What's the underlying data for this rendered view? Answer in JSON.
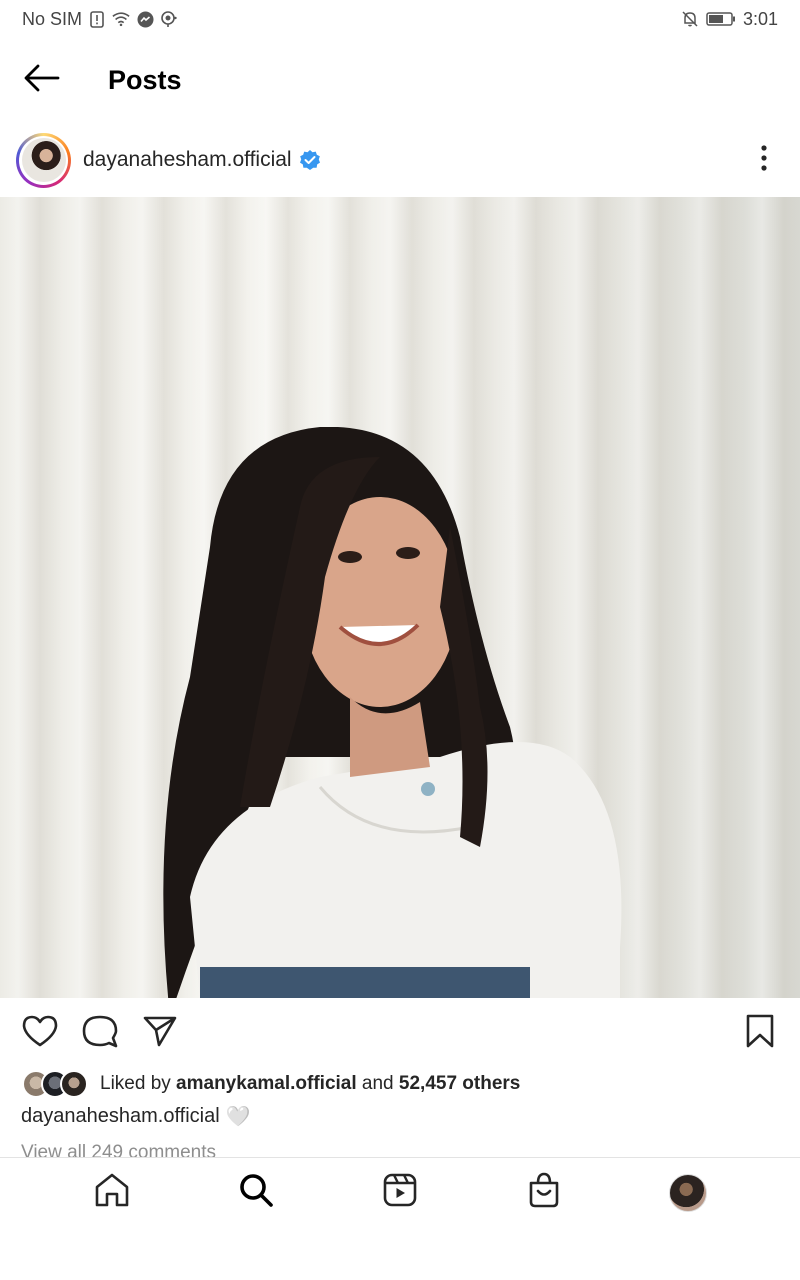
{
  "status_bar": {
    "carrier": "No SIM",
    "time": "3:01",
    "icons": [
      "sim-alert-icon",
      "wifi-icon",
      "messenger-icon",
      "hotspot-icon",
      "mute-bell-icon",
      "battery-icon"
    ]
  },
  "header": {
    "title": "Posts",
    "back_icon": "arrow-left-icon"
  },
  "post": {
    "author": "dayanahesham.official",
    "verified": true,
    "liked_by_prefix": "Liked by ",
    "liked_by_user": "amanykamal.official",
    "liked_by_and": " and ",
    "liked_by_others": "52,457 others",
    "caption_user": "dayanahesham.official",
    "caption_emoji": "🤍",
    "comments_link": "View all 249 comments"
  },
  "actions": {
    "icons": [
      "heart-icon",
      "comment-icon",
      "share-icon",
      "bookmark-icon"
    ]
  },
  "bottom_nav": {
    "items": [
      "home-icon",
      "search-icon",
      "reels-icon",
      "shop-icon",
      "profile-avatar"
    ]
  },
  "colors": {
    "verified_blue": "#3797f0",
    "text": "#262626",
    "secondary_text": "#8e8e8e"
  }
}
